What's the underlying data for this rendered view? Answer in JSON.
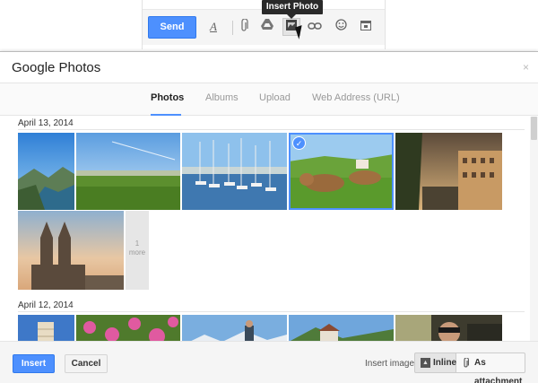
{
  "compose": {
    "send_label": "Send",
    "tooltip": "Insert Photo",
    "icons": [
      "text-format-icon",
      "paperclip-icon",
      "drive-icon",
      "insert-photo-icon",
      "link-icon",
      "emoji-icon",
      "calendar-icon"
    ]
  },
  "dialog": {
    "title": "Google Photos",
    "close": "×",
    "tabs": [
      {
        "label": "Photos",
        "active": true
      },
      {
        "label": "Albums",
        "active": false
      },
      {
        "label": "Upload",
        "active": false
      },
      {
        "label": "Web Address (URL)",
        "active": false
      }
    ],
    "groups": [
      {
        "date": "April 13, 2014",
        "more_number": "1",
        "more_text": "more"
      },
      {
        "date": "April 12, 2014"
      }
    ],
    "footer": {
      "insert": "Insert",
      "cancel": "Cancel",
      "insert_images_label": "Insert images",
      "inline": "Inline",
      "as_attachment": "As attachment"
    }
  },
  "colors": {
    "accent": "#4d90fe",
    "accent_border": "#3079ed"
  }
}
